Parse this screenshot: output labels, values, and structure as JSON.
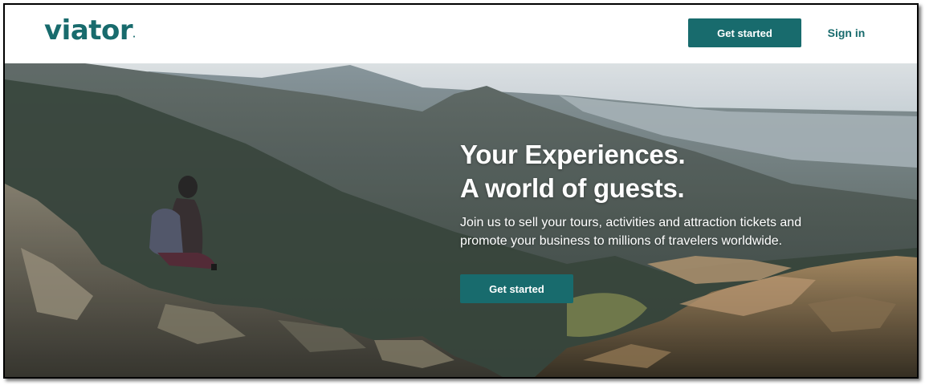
{
  "header": {
    "logo_text": "viator",
    "cta_label": "Get started",
    "signin_label": "Sign in"
  },
  "hero": {
    "headline_line1": "Your Experiences.",
    "headline_line2": "A world of guests.",
    "subtitle_line1": "Join us to sell your tours, activities and attraction tickets and",
    "subtitle_line2": "promote your business to millions of travelers worldwide.",
    "cta_label": "Get started"
  },
  "colors": {
    "brand": "#186b6d",
    "text_light": "#ffffff"
  }
}
